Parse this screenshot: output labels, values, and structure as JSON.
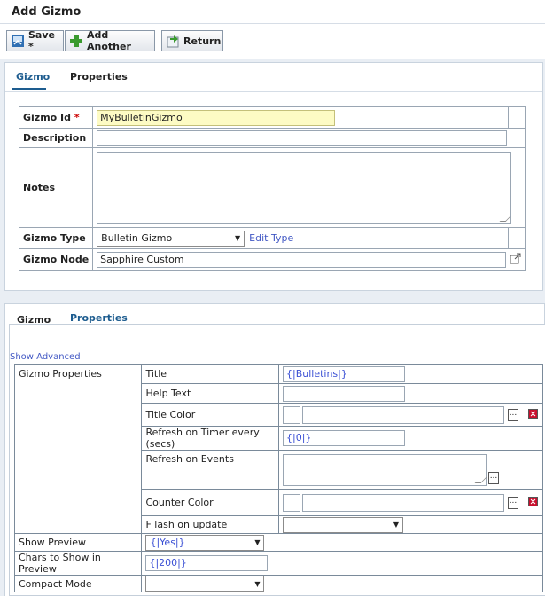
{
  "page": {
    "title": "Add Gizmo"
  },
  "toolbar": {
    "save": "Save *",
    "add_another": "Add Another",
    "return": "Return"
  },
  "panel1": {
    "tabs": [
      "Gizmo",
      "Properties"
    ],
    "fields": {
      "gizmo_id_label": "Gizmo Id",
      "gizmo_id_required": "*",
      "gizmo_id_value": "MyBulletinGizmo",
      "description_label": "Description",
      "description_value": "",
      "notes_label": "Notes",
      "notes_value": "",
      "gizmo_type_label": "Gizmo Type",
      "gizmo_type_value": "Bulletin Gizmo",
      "edit_type_link": "Edit Type",
      "gizmo_node_label": "Gizmo Node",
      "gizmo_node_value": "Sapphire Custom"
    }
  },
  "panel2": {
    "tabs": [
      "Gizmo",
      "Properties"
    ],
    "show_advanced": "Show Advanced",
    "group_label": "Gizmo Properties",
    "props": {
      "title_label": "Title",
      "title_value": "{|Bulletins|}",
      "help_text_label": "Help Text",
      "help_text_value": "",
      "title_color_label": "Title Color",
      "refresh_timer_label": "Refresh on Timer every (secs)",
      "refresh_timer_value": "{|0|}",
      "refresh_events_label": "Refresh on Events",
      "counter_color_label": "Counter Color",
      "flash_label": "F lash on update",
      "flash_value": ""
    },
    "show_preview_label": "Show Preview",
    "show_preview_value": "{|Yes|}",
    "chars_preview_label": "Chars to Show in Preview",
    "chars_preview_value": "{|200|}",
    "compact_label": "Compact Mode",
    "compact_value": ""
  }
}
